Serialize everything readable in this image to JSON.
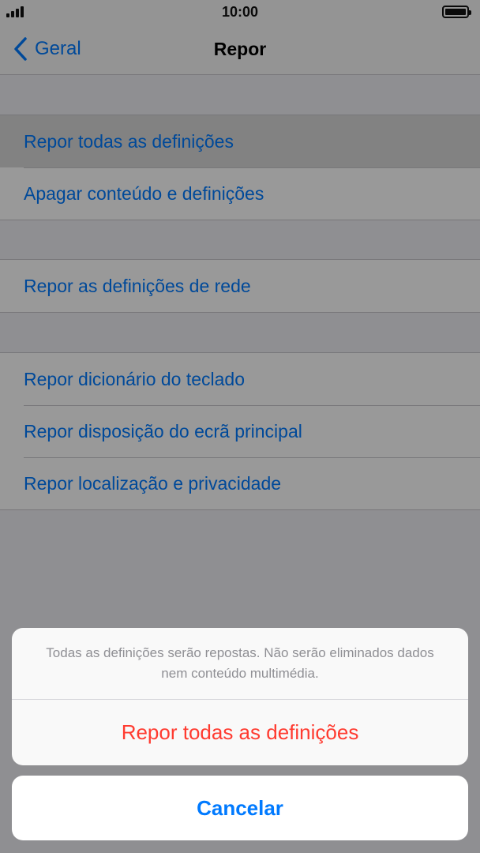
{
  "status_bar": {
    "time": "10:00"
  },
  "nav": {
    "back_label": "Geral",
    "title": "Repor"
  },
  "groups": [
    {
      "items": [
        {
          "label": "Repor todas as definições"
        },
        {
          "label": "Apagar conteúdo e definições"
        }
      ]
    },
    {
      "items": [
        {
          "label": "Repor as definições de rede"
        }
      ]
    },
    {
      "items": [
        {
          "label": "Repor dicionário do teclado"
        },
        {
          "label": "Repor disposição do ecrã principal"
        },
        {
          "label": "Repor localização e privacidade"
        }
      ]
    }
  ],
  "action_sheet": {
    "message": "Todas as definições serão repostas. Não serão eliminados dados nem conteúdo multimédia.",
    "action_label": "Repor todas as definições",
    "cancel_label": "Cancelar"
  },
  "colors": {
    "link": "#007aff",
    "destructive": "#ff3b30"
  }
}
